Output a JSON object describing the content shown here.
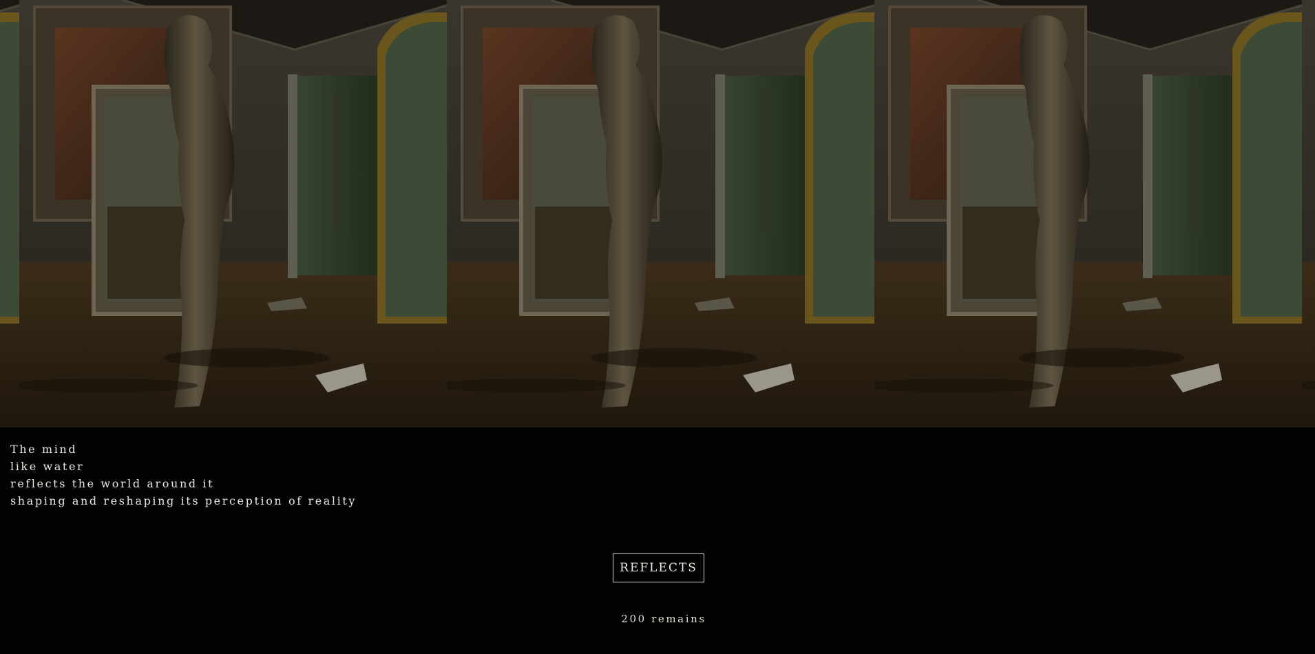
{
  "gallery": {
    "image_description_name": "statue-in-flooded-room-photo",
    "tile_count": 3
  },
  "poem": {
    "lines": [
      "The mind",
      "like water",
      "reflects the world around it",
      "shaping and reshaping its perception of reality"
    ]
  },
  "cta": {
    "label": "REFLECTS"
  },
  "counter": {
    "text": "200 remains"
  },
  "colors": {
    "background": "#030303",
    "text": "#ece8e0",
    "button_border": "#d9d4cb"
  }
}
